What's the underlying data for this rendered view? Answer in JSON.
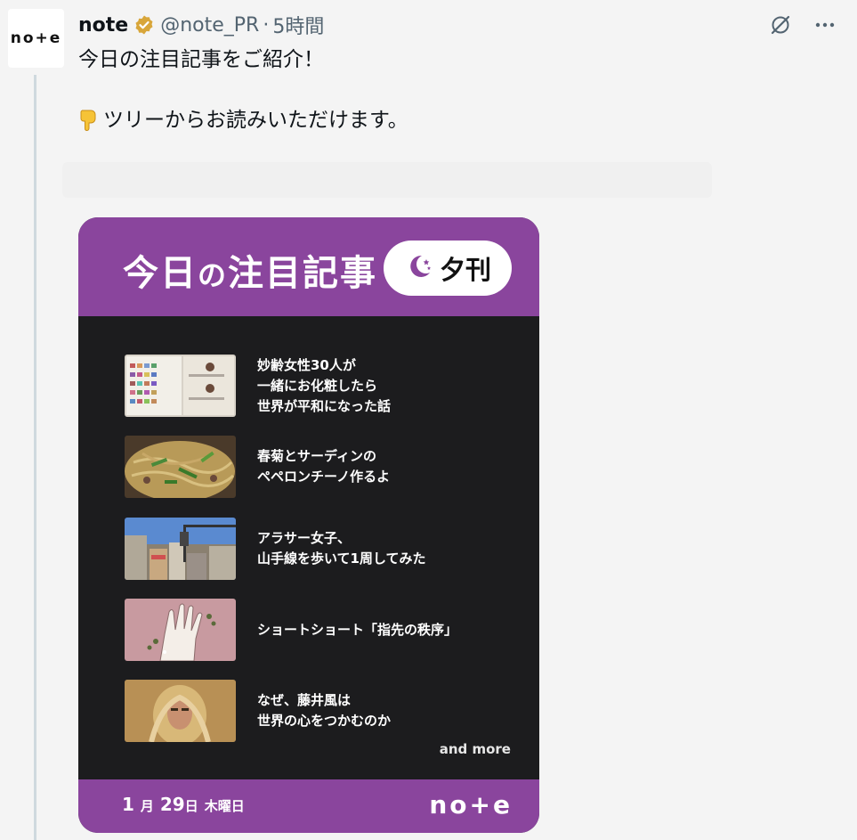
{
  "tweet": {
    "avatar_text": "no+e",
    "author": "note",
    "handle": "@note_PR",
    "separator": "·",
    "time": "5時間",
    "line1": "今日の注目記事をご紹介！",
    "line2": "ツリーからお読みいただけます。"
  },
  "card": {
    "title_part1": "今日",
    "title_no": "の",
    "title_part2": "注目記事",
    "pill_label": "夕刊",
    "items": [
      {
        "lines": [
          "妙齢女性30人が",
          "一緒にお化粧したら",
          "世界が平和になった話"
        ],
        "thumb": "makeup-color-chart-thumbnail"
      },
      {
        "lines": [
          "春菊とサーディンの",
          "ペペロンチーノ作るよ"
        ],
        "thumb": "pasta-dish-thumbnail"
      },
      {
        "lines": [
          "アラサー女子、",
          "山手線を歩いて1周してみた"
        ],
        "thumb": "city-street-thumbnail"
      },
      {
        "lines": [
          "ショートショート「指先の秩序」"
        ],
        "thumb": "hand-illustration-thumbnail"
      },
      {
        "lines": [
          "なぜ、藤井風は",
          "世界の心をつかむのか"
        ],
        "thumb": "portrait-thumbnail"
      }
    ],
    "and_more": "and more",
    "date_month": "1",
    "date_month_unit": "月",
    "date_day": "29",
    "date_day_unit": "日",
    "date_weekday": "木曜日",
    "footer_logo": "no+e"
  },
  "colors": {
    "brand_purple": "#8a459d",
    "card_dark": "#1c1c1e",
    "verified_gold": "#d8a63a"
  }
}
